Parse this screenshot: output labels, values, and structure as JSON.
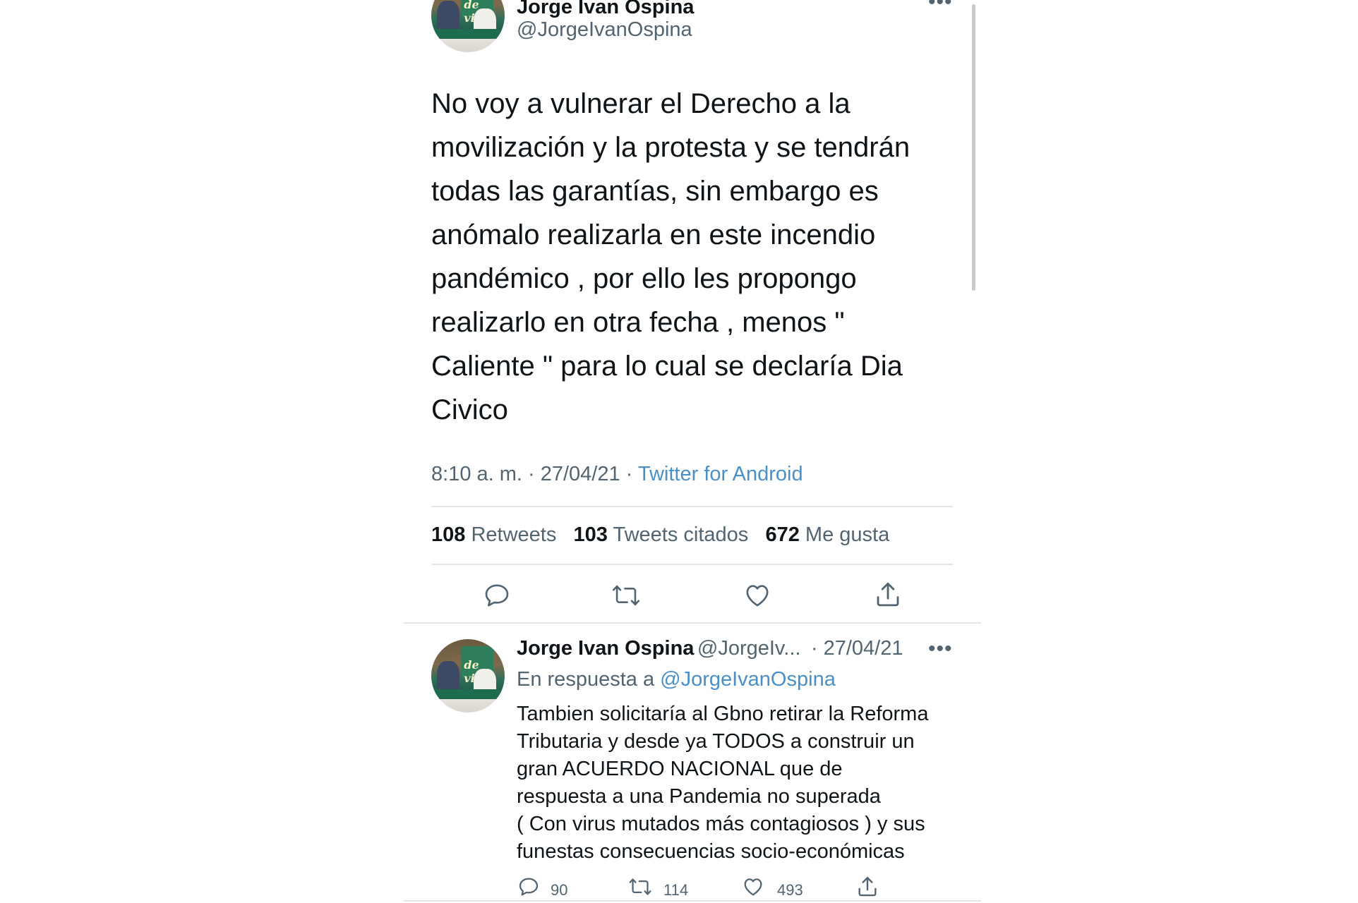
{
  "main_tweet": {
    "author_name": "Jorge Ivan Ospina",
    "author_handle": "@JorgeIvanOspina",
    "text": "No voy a vulnerar el Derecho a la\nmovilización y la protesta y se tendrán\ntodas las garantías, sin embargo es\nanómalo realizarla en este incendio\npandémico , por ello les propongo\nrealizarlo en otra fecha , menos \"\nCaliente \" para lo cual se declaría Dia\nCivico",
    "time": "8:10 a. m. · 27/04/21 · ",
    "source": "Twitter for Android",
    "stats": {
      "retweets_count": "108",
      "retweets_label": "Retweets",
      "quotes_count": "103",
      "quotes_label": "Tweets citados",
      "likes_count": "672",
      "likes_label": "Me gusta"
    },
    "more_icon": "more-dots-icon",
    "actions": [
      "reply-icon",
      "retweet-icon",
      "like-icon",
      "share-icon"
    ]
  },
  "reply_tweet": {
    "author_name": "Jorge Ivan Ospina",
    "author_handle": "@JorgeIv...",
    "date": "· 27/04/21",
    "reply_prefix": "En respuesta a ",
    "reply_to": "@JorgeIvanOspina",
    "text": "Tambien solicitaría al Gbno retirar la Reforma\nTributaria y desde ya TODOS a construir un\ngran ACUERDO NACIONAL que de\nrespuesta a una Pandemia no superada\n( Con virus mutados más contagiosos ) y sus\nfunestas consecuencias socio-económicas",
    "reply_count": "90",
    "retweet_count": "114",
    "like_count": "493"
  },
  "avatar_text": "de vida",
  "colors": {
    "text": "#0f1419",
    "secondary": "#536471",
    "link": "#4a90c8",
    "divider": "#e3e6e8"
  }
}
